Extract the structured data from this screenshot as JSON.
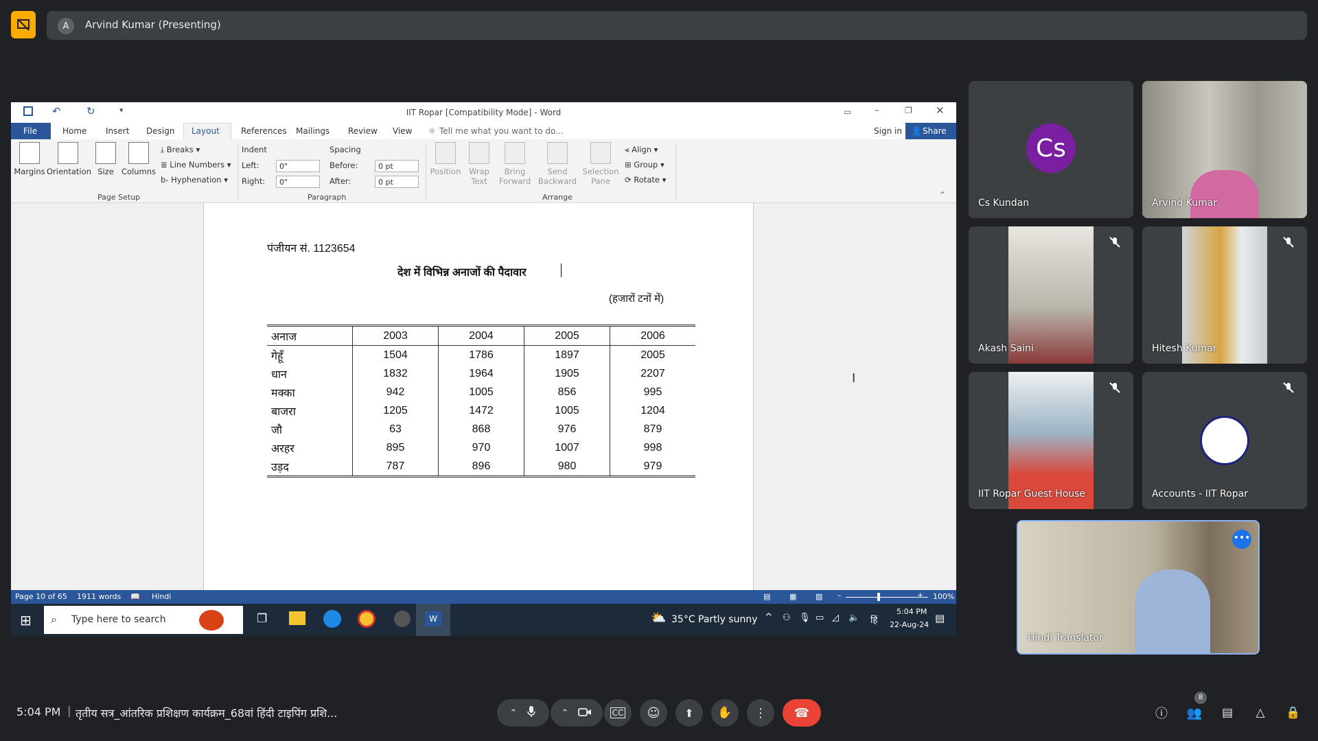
{
  "meet": {
    "presenter_initial": "A",
    "presenter_label": "Arvind Kumar (Presenting)",
    "accent_color": "#f9ab00",
    "participants": [
      {
        "initials": "Cs",
        "name": "Cs Kundan",
        "avatar_color": "#7b1fa2"
      },
      {
        "name": "Arvind Kumar"
      },
      {
        "name": "Akash Saini"
      },
      {
        "name": "Hitesh Kumar"
      },
      {
        "name": "IIT Ropar Guest House"
      },
      {
        "name": "Accounts - IIT Ropar"
      },
      {
        "name": "Hindi Translator"
      }
    ],
    "bottom": {
      "time": "5:04 PM",
      "meeting_title": "तृतीय सत्र_आंतरिक प्रशिक्षण कार्यक्रम_68वां हिंदी टाइपिंग प्रशि...",
      "people_count": "8"
    }
  },
  "word": {
    "window_title": "IIT Ropar [Compatibility Mode] - Word",
    "tabs": [
      "File",
      "Home",
      "Insert",
      "Design",
      "Layout",
      "References",
      "Mailings",
      "Review",
      "View"
    ],
    "active_tab": "Layout",
    "tell_me": "Tell me what you want to do...",
    "sign_in": "Sign in",
    "share": "Share",
    "page_setup": {
      "margins": "Margins",
      "orientation": "Orientation",
      "size": "Size",
      "columns": "Columns",
      "breaks": "Breaks",
      "line_numbers": "Line Numbers",
      "hyphenation": "Hyphenation",
      "group_label": "Page Setup"
    },
    "paragraph": {
      "indent": "Indent",
      "spacing": "Spacing",
      "left_label": "Left:",
      "left_value": "0\"",
      "right_label": "Right:",
      "right_value": "0\"",
      "before_label": "Before:",
      "before_value": "0 pt",
      "after_label": "After:",
      "after_value": "0 pt",
      "group_label": "Paragraph"
    },
    "arrange": {
      "position": "Position",
      "wrap_1": "Wrap",
      "wrap_2": "Text",
      "bring_1": "Bring",
      "bring_2": "Forward",
      "send_1": "Send",
      "send_2": "Backward",
      "selection_1": "Selection",
      "selection_2": "Pane",
      "align": "Align",
      "group": "Group",
      "rotate": "Rotate",
      "group_label": "Arrange"
    },
    "document": {
      "reg_no": "पंजीयन सं. 1123654",
      "heading": "देश में विभिन्न अनाजों की पैदावार",
      "unit": "(हजारों टनों में)",
      "columns": [
        "अनाज",
        "2003",
        "2004",
        "2005",
        "2006"
      ],
      "rows": [
        [
          "गेहूँ",
          "1504",
          "1786",
          "1897",
          "2005"
        ],
        [
          "धान",
          "1832",
          "1964",
          "1905",
          "2207"
        ],
        [
          "मक्का",
          "942",
          "1005",
          "856",
          "995"
        ],
        [
          "बाजरा",
          "1205",
          "1472",
          "1005",
          "1204"
        ],
        [
          "जौ",
          "63",
          "868",
          "976",
          "879"
        ],
        [
          "अरहर",
          "895",
          "970",
          "1007",
          "998"
        ],
        [
          "उड़द",
          "787",
          "896",
          "980",
          "979"
        ]
      ]
    },
    "status": {
      "page": "Page 10 of 65",
      "words": "1911 words",
      "language": "Hindi",
      "zoom": "100%"
    }
  },
  "taskbar": {
    "search_placeholder": "Type here to search",
    "weather": "35°C  Partly sunny",
    "ime": "हिं",
    "time": "5:04 PM",
    "date": "22-Aug-24"
  }
}
